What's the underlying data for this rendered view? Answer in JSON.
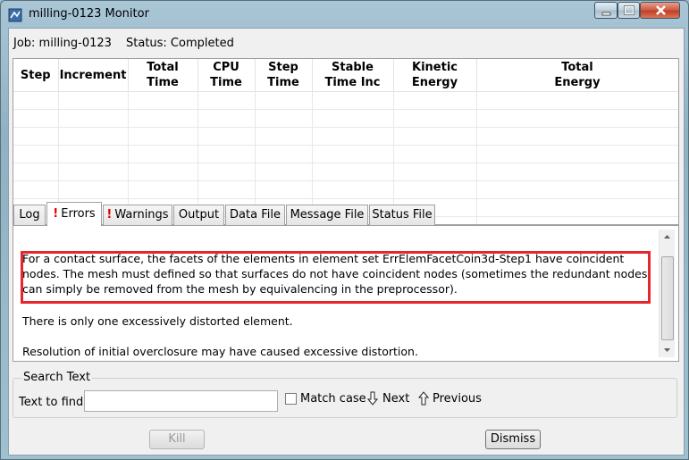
{
  "window": {
    "title": "milling-0123 Monitor"
  },
  "job": {
    "job_text": "Job:  milling-0123",
    "status_text": "Status:  Completed"
  },
  "table": {
    "columns": [
      "Step",
      "Increment",
      "Total Time",
      "CPU Time",
      "Step Time",
      "Stable Time Inc",
      "Kinetic Energy",
      "Total Energy"
    ],
    "rows": []
  },
  "tabs": [
    {
      "label": "Log",
      "alert": ""
    },
    {
      "label": "Errors",
      "alert": "!"
    },
    {
      "label": "Warnings",
      "alert": "!"
    },
    {
      "label": "Output",
      "alert": ""
    },
    {
      "label": "Data File",
      "alert": ""
    },
    {
      "label": "Message File",
      "alert": ""
    },
    {
      "label": "Status File",
      "alert": ""
    }
  ],
  "active_tab": "Errors",
  "messages": [
    "For a contact surface, the facets of the elements in element set ErrElemFacetCoin3d-Step1 have coincident nodes. The mesh must defined so that surfaces do not have coincident nodes (sometimes the redundant nodes can simply be removed from the mesh by equivalencing in the preprocessor).",
    "There is only one excessively distorted element.",
    "Resolution of initial overclosure may have caused excessive distortion."
  ],
  "highlight_color": "#e8252c",
  "search": {
    "group_title": "Search Text",
    "find_label": "Text to find:",
    "find_value": "",
    "match_case_label": "Match case",
    "match_case_checked": false,
    "next_label": "Next",
    "previous_label": "Previous"
  },
  "buttons": {
    "kill": "Kill",
    "dismiss": "Dismiss"
  },
  "icons": [
    "app-icon",
    "minimize-icon",
    "maximize-icon",
    "close-icon",
    "arrow-down-icon",
    "arrow-up-icon"
  ]
}
